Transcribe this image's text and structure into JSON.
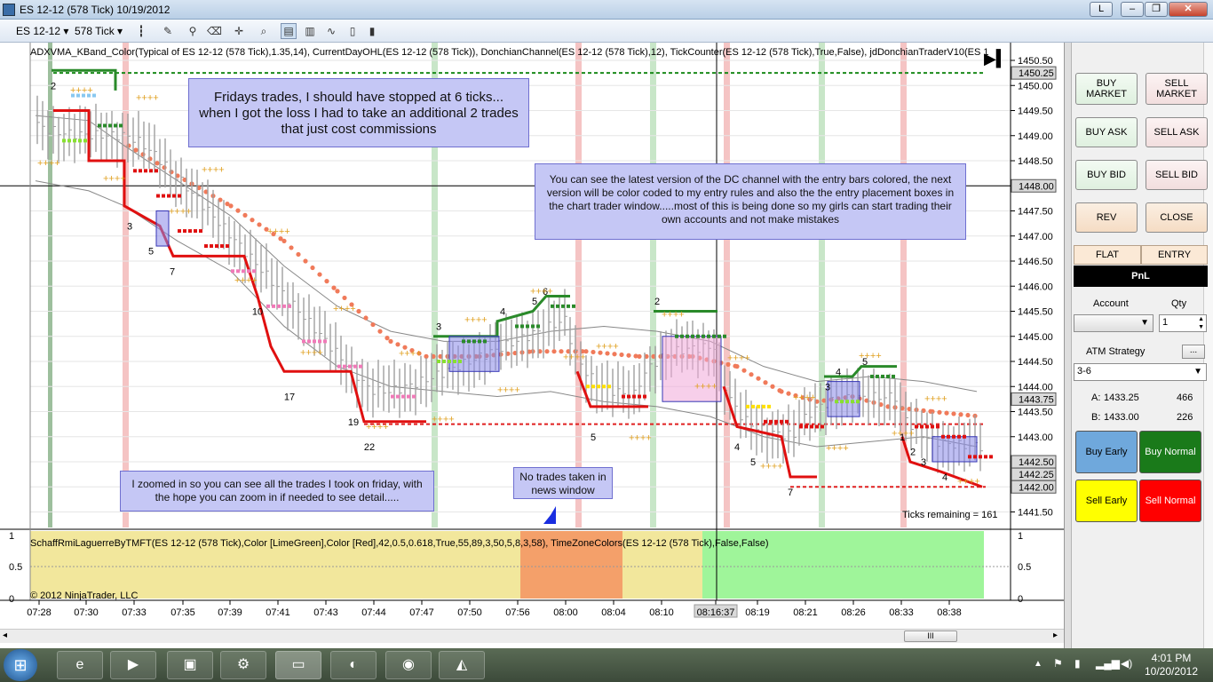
{
  "window": {
    "title": "ES 12-12 (578 Tick)  10/19/2012",
    "button_l": "L"
  },
  "toolbar": {
    "instrument": "ES 12-12",
    "period": "578 Tick"
  },
  "chart": {
    "indicators_label": "ADXVMA_KBand_Color(Typical of ES 12-12 (578 Tick),1.35,14), CurrentDayOHL(ES 12-12 (578 Tick)), DonchianChannel(ES 12-12 (578 Tick),12), TickCounter(ES 12-12 (578 Tick),True,False), jdDonchianTraderV10(ES 1",
    "lower_label": "SchaffRmiLaguerreByTMFT(ES 12-12 (578 Tick),Color [LimeGreen],Color [Red],42,0.5,0.618,True,55,89,3,50,5,8,3,58), TimeZoneColors(ES 12-12 (578 Tick),False,False)",
    "copyright": "© 2012 NinjaTrader, LLC",
    "ticks_remaining": "Ticks remaining = 161",
    "price_ticks": [
      "1450.50",
      "1450.00",
      "1449.50",
      "1449.00",
      "1448.50",
      "1448.00",
      "1447.50",
      "1447.00",
      "1446.50",
      "1446.00",
      "1445.50",
      "1445.00",
      "1444.50",
      "1444.00",
      "1443.50",
      "1443.00",
      "1442.50",
      "1442.00",
      "1441.50"
    ],
    "price_markers": [
      {
        "label": "1450.25",
        "color": "#ffffff"
      },
      {
        "label": "1448.00",
        "color": "#ffffff"
      },
      {
        "label": "1443.75",
        "color": "#ffffff"
      },
      {
        "label": "1442.50",
        "color": "#ffffff"
      },
      {
        "label": "1442.25",
        "color": "#ffffff"
      },
      {
        "label": "1442.00",
        "color": "#ffffff"
      }
    ],
    "lower_ticks": [
      "1",
      "0.5",
      "0"
    ],
    "time_ticks": [
      "07:28",
      "07:30",
      "07:33",
      "07:35",
      "07:39",
      "07:41",
      "07:43",
      "07:44",
      "07:47",
      "07:50",
      "07:56",
      "08:00",
      "08:04",
      "08:10",
      "08:16:37",
      "08:19",
      "08:21",
      "08:26",
      "08:33",
      "08:38"
    ],
    "trade_numbers": [
      "2",
      "3",
      "5",
      "7",
      "10",
      "17",
      "19",
      "22",
      "3",
      "4",
      "5",
      "6",
      "5",
      "2",
      "4",
      "5",
      "7",
      "3",
      "4",
      "5",
      "1",
      "2",
      "3",
      "4"
    ],
    "notes": {
      "friday": "Fridays trades, I should have stopped at 6 ticks... when I got the loss I had to take an additional 2 trades that just cost commissions",
      "dc": "You can see the latest version of the DC channel with the entry bars colored, the next version will be color coded to my entry rules and also the the entry placement boxes in the chart trader window.....most of this is being done so my girls can start trading their own accounts and not make mistakes",
      "zoom": "I zoomed in so you can see all the trades I took on friday, with the hope you can zoom in if needed to see detail.....",
      "news": "No trades taken in news window"
    }
  },
  "chart_trader": {
    "buy_market": "BUY MARKET",
    "sell_market": "SELL MARKET",
    "buy_ask": "BUY ASK",
    "sell_ask": "SELL ASK",
    "buy_bid": "BUY BID",
    "sell_bid": "SELL BID",
    "rev": "REV",
    "close": "CLOSE",
    "flat": "FLAT",
    "entry": "ENTRY",
    "pnl": "PnL",
    "account_label": "Account",
    "qty_label": "Qty",
    "qty_value": "1",
    "atm_label": "ATM Strategy",
    "atm_more": "...",
    "atm_value": "3-6",
    "ask_label": "A:",
    "ask_price": "1433.25",
    "ask_size": "466",
    "bid_label": "B:",
    "bid_price": "1433.00",
    "bid_size": "226",
    "buy_early": "Buy Early",
    "buy_normal": "Buy Normal",
    "sell_early": "Sell Early",
    "sell_normal": "Sell Normal",
    "colors": {
      "buy_early": "#6fa8dc",
      "buy_normal": "#1a7a1a",
      "sell_early": "#ffff00",
      "sell_normal": "#ff0000"
    }
  },
  "scrollbar": {
    "thumb_glyph": "III"
  },
  "taskbar": {
    "time": "4:01 PM",
    "date": "10/20/2012"
  }
}
